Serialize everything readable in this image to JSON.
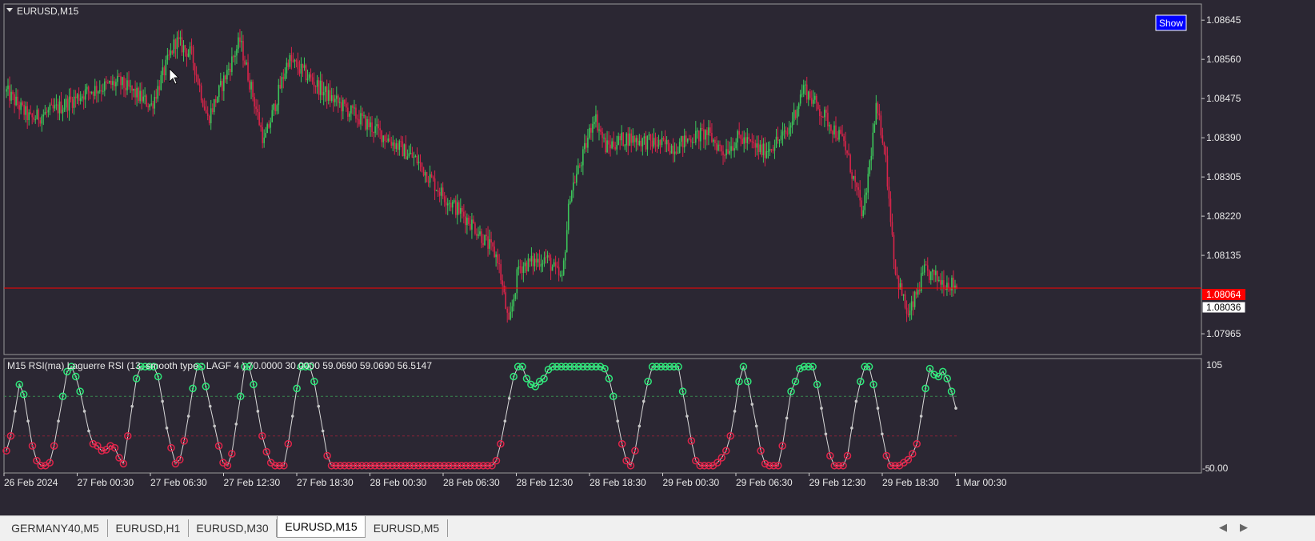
{
  "window": {
    "title": "EURUSD,M15",
    "show_button": "Show"
  },
  "price_axis": {
    "ticks": [
      "1.08645",
      "1.08560",
      "1.08475",
      "1.08390",
      "1.08305",
      "1.08220",
      "1.08135",
      "1.07965"
    ],
    "current_price": "1.08064",
    "current_price_color": "#ff0000",
    "bid_label": "1.08036"
  },
  "indicator": {
    "label": "M15 RSI(ma) Laguerre RSI (13, smooth type : LAGF  4 ) 70.0000 30.0000 59.0690 59.0690 56.5147",
    "axis_top": "105",
    "axis_bottom": "-5",
    "axis_bottom2": "0.00",
    "levels": [
      70,
      30
    ],
    "colors": {
      "overbought": "#2ee87a",
      "oversold": "#e0244a",
      "neutral": "#c8c8c8"
    }
  },
  "time_axis": [
    "26 Feb 2024",
    "27 Feb 00:30",
    "27 Feb 06:30",
    "27 Feb 12:30",
    "27 Feb 18:30",
    "28 Feb 00:30",
    "28 Feb 06:30",
    "28 Feb 12:30",
    "28 Feb 18:30",
    "29 Feb 00:30",
    "29 Feb 06:30",
    "29 Feb 12:30",
    "29 Feb 18:30",
    "1 Mar 00:30"
  ],
  "tabs": [
    "GERMANY40,M5",
    "EURUSD,H1",
    "EURUSD,M30",
    "EURUSD,M15",
    "EURUSD,M5"
  ],
  "active_tab": "EURUSD,M15",
  "chart_data": [
    {
      "type": "candlestick",
      "title": "EURUSD,M15",
      "ylim": [
        1.0792,
        1.0868
      ],
      "bull_color": "#3cc55a",
      "bear_color": "#d8244a",
      "close_path": [
        [
          0,
          1.0849
        ],
        [
          15,
          1.0843
        ],
        [
          30,
          1.0845
        ],
        [
          50,
          1.0849
        ],
        [
          70,
          1.0851
        ],
        [
          90,
          1.0846
        ],
        [
          105,
          1.086
        ],
        [
          115,
          1.0857
        ],
        [
          125,
          1.0843
        ],
        [
          145,
          1.086
        ],
        [
          160,
          1.0838
        ],
        [
          175,
          1.0856
        ],
        [
          185,
          1.0853
        ],
        [
          200,
          1.0848
        ],
        [
          220,
          1.0843
        ],
        [
          240,
          1.0838
        ],
        [
          255,
          1.0834
        ],
        [
          270,
          1.0827
        ],
        [
          290,
          1.082
        ],
        [
          305,
          1.0813
        ],
        [
          312,
          1.0798
        ],
        [
          318,
          1.0811
        ],
        [
          335,
          1.0813
        ],
        [
          345,
          1.0808
        ],
        [
          350,
          1.0827
        ],
        [
          358,
          1.0835
        ],
        [
          365,
          1.0844
        ],
        [
          372,
          1.0837
        ],
        [
          385,
          1.0839
        ],
        [
          400,
          1.0838
        ],
        [
          415,
          1.0837
        ],
        [
          425,
          1.0839
        ],
        [
          435,
          1.084
        ],
        [
          445,
          1.0836
        ],
        [
          455,
          1.0839
        ],
        [
          470,
          1.0836
        ],
        [
          485,
          1.084
        ],
        [
          495,
          1.085
        ],
        [
          505,
          1.0845
        ],
        [
          520,
          1.0838
        ],
        [
          532,
          1.0822
        ],
        [
          540,
          1.0845
        ],
        [
          545,
          1.0838
        ],
        [
          552,
          1.081
        ],
        [
          560,
          1.08
        ],
        [
          570,
          1.081
        ],
        [
          580,
          1.0808
        ],
        [
          590,
          1.0807
        ]
      ]
    },
    {
      "type": "line",
      "title": "Laguerre RSI (13, smooth type : LAGF  4 )",
      "ylim": [
        -5,
        105
      ],
      "levels": [
        70,
        30
      ],
      "values": [
        15,
        30,
        55,
        82,
        72,
        45,
        20,
        5,
        0,
        0,
        3,
        20,
        45,
        70,
        95,
        100,
        90,
        75,
        55,
        35,
        22,
        20,
        15,
        16,
        20,
        18,
        8,
        2,
        30,
        60,
        88,
        100,
        100,
        100,
        100,
        90,
        65,
        38,
        18,
        2,
        6,
        25,
        50,
        78,
        100,
        100,
        80,
        60,
        40,
        20,
        3,
        0,
        12,
        42,
        70,
        100,
        100,
        82,
        55,
        30,
        14,
        3,
        0,
        0,
        0,
        22,
        50,
        78,
        100,
        100,
        100,
        85,
        60,
        35,
        10,
        0,
        0,
        0,
        0,
        0,
        0,
        0,
        0,
        0,
        0,
        0,
        0,
        0,
        0,
        0,
        0,
        0,
        0,
        0,
        0,
        0,
        0,
        0,
        0,
        0,
        0,
        0,
        0,
        0,
        0,
        0,
        0,
        0,
        0,
        0,
        0,
        0,
        0,
        5,
        22,
        45,
        68,
        90,
        100,
        100,
        88,
        82,
        80,
        85,
        88,
        97,
        100,
        100,
        100,
        100,
        100,
        100,
        100,
        100,
        100,
        100,
        100,
        100,
        98,
        88,
        70,
        45,
        22,
        5,
        0,
        15,
        40,
        65,
        85,
        100,
        100,
        100,
        100,
        100,
        100,
        100,
        75,
        50,
        25,
        5,
        0,
        0,
        0,
        0,
        3,
        8,
        15,
        30,
        55,
        85,
        100,
        85,
        62,
        40,
        15,
        2,
        0,
        0,
        0,
        20,
        48,
        75,
        85,
        98,
        100,
        100,
        100,
        82,
        58,
        32,
        10,
        0,
        0,
        0,
        10,
        38,
        65,
        85,
        100,
        100,
        82,
        58,
        32,
        10,
        0,
        0,
        0,
        3,
        6,
        12,
        22,
        50,
        78,
        98,
        92,
        90,
        95,
        88,
        75,
        58
      ]
    }
  ]
}
